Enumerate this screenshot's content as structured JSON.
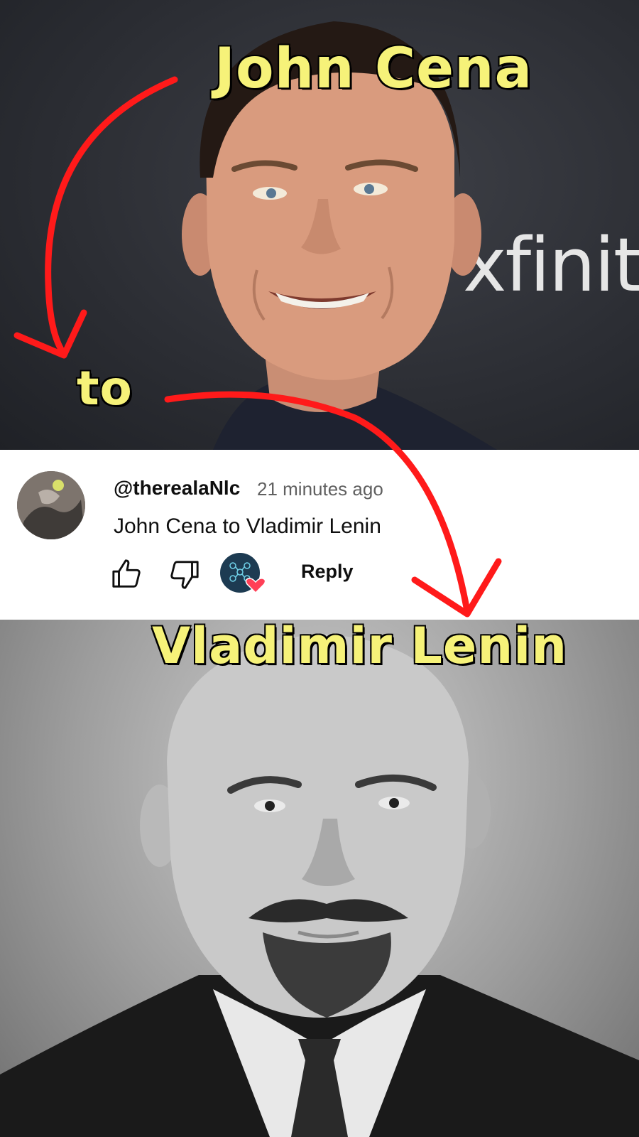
{
  "captions": {
    "top": "John Cena",
    "middle": "to",
    "bottom": "Vladimir Lenin"
  },
  "backdrop_text": "xfinit",
  "comment": {
    "handle": "@therealaNlc",
    "time": "21 minutes ago",
    "text": "John Cena to Vladimir Lenin",
    "reply_label": "Reply",
    "like_icon": "thumbs-up-icon",
    "dislike_icon": "thumbs-down-icon",
    "creator_heart_icon": "creator-heart-icon"
  },
  "colors": {
    "caption": "#f6f279",
    "arrow": "#ff1a1a",
    "card_bg": "#ffffff",
    "heart": "#ff4057"
  }
}
